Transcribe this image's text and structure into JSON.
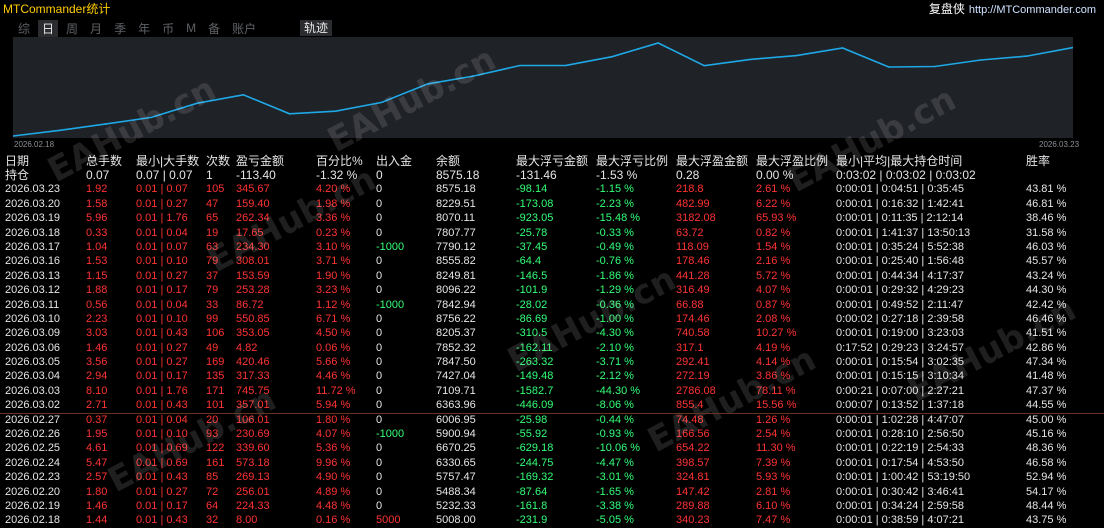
{
  "app_title": "MTCommander统计",
  "brand": {
    "name": "复盘侠",
    "url": "http://MTCommander.com"
  },
  "tabs": [
    {
      "label": "综",
      "active": false
    },
    {
      "label": "日",
      "active": true
    },
    {
      "label": "周",
      "active": false
    },
    {
      "label": "月",
      "active": false
    },
    {
      "label": "季",
      "active": false
    },
    {
      "label": "年",
      "active": false
    },
    {
      "label": "币",
      "active": false
    },
    {
      "label": "M",
      "active": false
    },
    {
      "label": "备",
      "active": false
    },
    {
      "label": "账户",
      "active": false
    }
  ],
  "track_tab": "轨迹",
  "chart": {
    "start_date": "2026.02.18",
    "end_date": "2026.03.23",
    "line_color": "#1fa8e6",
    "equity": [
      5008,
      5232.33,
      5488.34,
      5757.47,
      6330.65,
      6670.25,
      5900.94,
      6006.95,
      6363.96,
      7109.71,
      7427.04,
      7847.5,
      7852.32,
      8205.37,
      8756.22,
      7842.94,
      8096.22,
      8249.81,
      8555.82,
      7790.12,
      7807.77,
      8070.11,
      8229.51,
      8575.18
    ]
  },
  "columns": [
    "日期",
    "总手数",
    "最小|大手数",
    "次数",
    "盈亏金额",
    "百分比%",
    "出入金",
    "余额",
    "最大浮亏金额",
    "最大浮亏比例",
    "最大浮盈金额",
    "最大浮盈比例",
    "最小|平均|最大持仓时间",
    "胜率"
  ],
  "holding": {
    "label": "持仓",
    "lots": "0.07",
    "minmax": "0.07 | 0.07",
    "count": "1",
    "pnl": "-113.40",
    "pct": "-1.32 %",
    "flow": "0",
    "balance": "8575.18",
    "max_float_loss": "-131.46",
    "max_float_loss_pct": "-1.53 %",
    "max_float_profit": "0.28",
    "max_float_profit_pct": "0.00 %",
    "hold_time": "0:03:02 | 0:03:02 | 0:03:02",
    "win_rate": ""
  },
  "rows": [
    {
      "date": "2026.03.23",
      "lots": "1.92",
      "minmax": "0.01 | 0.07",
      "count": "105",
      "pnl": "345.67",
      "pct": "4.20 %",
      "flow": "0",
      "balance": "8575.18",
      "mfl": "-98.14",
      "mflp": "-1.15 %",
      "mfp": "218.8",
      "mfpp": "2.61 %",
      "hold": "0:00:01 | 0:04:51 | 0:35:45",
      "win": "43.81 %"
    },
    {
      "date": "2026.03.20",
      "lots": "1.58",
      "minmax": "0.01 | 0.27",
      "count": "47",
      "pnl": "159.40",
      "pct": "1.98 %",
      "flow": "0",
      "balance": "8229.51",
      "mfl": "-173.08",
      "mflp": "-2.23 %",
      "mfp": "482.99",
      "mfpp": "6.22 %",
      "hold": "0:00:01 | 0:16:32 | 1:42:41",
      "win": "46.81 %"
    },
    {
      "date": "2026.03.19",
      "lots": "5.96",
      "minmax": "0.01 | 1.76",
      "count": "65",
      "pnl": "262.34",
      "pct": "3.36 %",
      "flow": "0",
      "balance": "8070.11",
      "mfl": "-923.05",
      "mflp": "-15.48 %",
      "mfp": "3182.08",
      "mfpp": "65.93 %",
      "hold": "0:00:01 | 0:11:35 | 2:12:14",
      "win": "38.46 %"
    },
    {
      "date": "2026.03.18",
      "lots": "0.33",
      "minmax": "0.01 | 0.04",
      "count": "19",
      "pnl": "17.65",
      "pct": "0.23 %",
      "flow": "0",
      "balance": "7807.77",
      "mfl": "-25.78",
      "mflp": "-0.33 %",
      "mfp": "63.72",
      "mfpp": "0.82 %",
      "hold": "0:00:01 | 1:41:37 | 13:50:13",
      "win": "31.58 %"
    },
    {
      "date": "2026.03.17",
      "lots": "1.04",
      "minmax": "0.01 | 0.07",
      "count": "63",
      "pnl": "234.30",
      "pct": "3.10 %",
      "flow": "-1000",
      "balance": "7790.12",
      "mfl": "-37.45",
      "mflp": "-0.49 %",
      "mfp": "118.09",
      "mfpp": "1.54 %",
      "hold": "0:00:01 | 0:35:24 | 5:52:38",
      "win": "46.03 %"
    },
    {
      "date": "2026.03.16",
      "lots": "1.53",
      "minmax": "0.01 | 0.10",
      "count": "79",
      "pnl": "308.01",
      "pct": "3.71 %",
      "flow": "0",
      "balance": "8555.82",
      "mfl": "-64.4",
      "mflp": "-0.76 %",
      "mfp": "178.46",
      "mfpp": "2.16 %",
      "hold": "0:00:01 | 0:25:40 | 1:56:48",
      "win": "45.57 %"
    },
    {
      "date": "2026.03.13",
      "lots": "1.15",
      "minmax": "0.01 | 0.27",
      "count": "37",
      "pnl": "153.59",
      "pct": "1.90 %",
      "flow": "0",
      "balance": "8249.81",
      "mfl": "-146.5",
      "mflp": "-1.86 %",
      "mfp": "441.28",
      "mfpp": "5.72 %",
      "hold": "0:00:01 | 0:44:34 | 4:17:37",
      "win": "43.24 %"
    },
    {
      "date": "2026.03.12",
      "lots": "1.88",
      "minmax": "0.01 | 0.17",
      "count": "79",
      "pnl": "253.28",
      "pct": "3.23 %",
      "flow": "0",
      "balance": "8096.22",
      "mfl": "-101.9",
      "mflp": "-1.29 %",
      "mfp": "316.49",
      "mfpp": "4.07 %",
      "hold": "0:00:01 | 0:29:32 | 4:29:23",
      "win": "44.30 %"
    },
    {
      "date": "2026.03.11",
      "lots": "0.56",
      "minmax": "0.01 | 0.04",
      "count": "33",
      "pnl": "86.72",
      "pct": "1.12 %",
      "flow": "-1000",
      "balance": "7842.94",
      "mfl": "-28.02",
      "mflp": "-0.36 %",
      "mfp": "66.88",
      "mfpp": "0.87 %",
      "hold": "0:00:01 | 0:49:52 | 2:11:47",
      "win": "42.42 %"
    },
    {
      "date": "2026.03.10",
      "lots": "2.23",
      "minmax": "0.01 | 0.10",
      "count": "99",
      "pnl": "550.85",
      "pct": "6.71 %",
      "flow": "0",
      "balance": "8756.22",
      "mfl": "-86.69",
      "mflp": "-1.00 %",
      "mfp": "174.46",
      "mfpp": "2.08 %",
      "hold": "0:00:02 | 0:27:18 | 2:39:58",
      "win": "46.46 %"
    },
    {
      "date": "2026.03.09",
      "lots": "3.03",
      "minmax": "0.01 | 0.43",
      "count": "106",
      "pnl": "353.05",
      "pct": "4.50 %",
      "flow": "0",
      "balance": "8205.37",
      "mfl": "-310.5",
      "mflp": "-4.30 %",
      "mfp": "740.58",
      "mfpp": "10.27 %",
      "hold": "0:00:01 | 0:19:00 | 3:23:03",
      "win": "41.51 %"
    },
    {
      "date": "2026.03.06",
      "lots": "1.46",
      "minmax": "0.01 | 0.27",
      "count": "49",
      "pnl": "4.82",
      "pct": "0.06 %",
      "flow": "0",
      "balance": "7852.32",
      "mfl": "-162.11",
      "mflp": "-2.10 %",
      "mfp": "317.1",
      "mfpp": "4.19 %",
      "hold": "0:17:52 | 0:29:23 | 3:24:57",
      "win": "42.86 %"
    },
    {
      "date": "2026.03.05",
      "lots": "3.56",
      "minmax": "0.01 | 0.27",
      "count": "169",
      "pnl": "420.46",
      "pct": "5.66 %",
      "flow": "0",
      "balance": "7847.50",
      "mfl": "-263.32",
      "mflp": "-3.71 %",
      "mfp": "292.41",
      "mfpp": "4.14 %",
      "hold": "0:00:01 | 0:15:54 | 3:02:35",
      "win": "47.34 %"
    },
    {
      "date": "2026.03.04",
      "lots": "2.94",
      "minmax": "0.01 | 0.17",
      "count": "135",
      "pnl": "317.33",
      "pct": "4.46 %",
      "flow": "0",
      "balance": "7427.04",
      "mfl": "-149.48",
      "mflp": "-2.12 %",
      "mfp": "272.19",
      "mfpp": "3.86 %",
      "hold": "0:00:01 | 0:15:15 | 3:10:34",
      "win": "41.48 %"
    },
    {
      "date": "2026.03.03",
      "lots": "8.10",
      "minmax": "0.01 | 1.76",
      "count": "171",
      "pnl": "745.75",
      "pct": "11.72 %",
      "flow": "0",
      "balance": "7109.71",
      "mfl": "-1582.7",
      "mflp": "-44.30 %",
      "mfp": "2786.08",
      "mfpp": "78.11 %",
      "hold": "0:00:21 | 0:07:00 | 2:27:21",
      "win": "47.37 %"
    },
    {
      "date": "2026.03.02",
      "lots": "2.71",
      "minmax": "0.01 | 0.43",
      "count": "101",
      "pnl": "357.01",
      "pct": "5.94 %",
      "flow": "0",
      "balance": "6363.96",
      "mfl": "-446.09",
      "mflp": "-8.06 %",
      "mfp": "855.4",
      "mfpp": "15.56 %",
      "hold": "0:00:07 | 0:13:52 | 1:37:18",
      "win": "44.55 %"
    },
    {
      "date": "2026.02.27",
      "lots": "0.37",
      "minmax": "0.01 | 0.04",
      "count": "20",
      "pnl": "106.01",
      "pct": "1.80 %",
      "flow": "0",
      "balance": "6006.95",
      "mfl": "-25.98",
      "mflp": "-0.44 %",
      "mfp": "74.48",
      "mfpp": "1.26 %",
      "hold": "0:00:01 | 1:02:28 | 4:47:07",
      "win": "45.00 %"
    },
    {
      "date": "2026.02.26",
      "lots": "1.95",
      "minmax": "0.01 | 0.10",
      "count": "93",
      "pnl": "230.69",
      "pct": "4.07 %",
      "flow": "-1000",
      "balance": "5900.94",
      "mfl": "-55.92",
      "mflp": "-0.93 %",
      "mfp": "166.56",
      "mfpp": "2.54 %",
      "hold": "0:00:01 | 0:28:10 | 2:56:50",
      "win": "45.16 %"
    },
    {
      "date": "2026.02.25",
      "lots": "4.61",
      "minmax": "0.01 | 0.69",
      "count": "122",
      "pnl": "339.60",
      "pct": "5.36 %",
      "flow": "0",
      "balance": "6670.25",
      "mfl": "-629.18",
      "mflp": "-10.06 %",
      "mfp": "654.22",
      "mfpp": "11.30 %",
      "hold": "0:00:01 | 0:22:19 | 2:54:33",
      "win": "48.36 %"
    },
    {
      "date": "2026.02.24",
      "lots": "5.47",
      "minmax": "0.01 | 0.69",
      "count": "161",
      "pnl": "573.18",
      "pct": "9.96 %",
      "flow": "0",
      "balance": "6330.65",
      "mfl": "-244.75",
      "mflp": "-4.47 %",
      "mfp": "398.57",
      "mfpp": "7.39 %",
      "hold": "0:00:01 | 0:17:54 | 4:53:50",
      "win": "46.58 %"
    },
    {
      "date": "2026.02.23",
      "lots": "2.57",
      "minmax": "0.01 | 0.43",
      "count": "85",
      "pnl": "269.13",
      "pct": "4.90 %",
      "flow": "0",
      "balance": "5757.47",
      "mfl": "-169.32",
      "mflp": "-3.01 %",
      "mfp": "324.81",
      "mfpp": "5.93 %",
      "hold": "0:00:01 | 1:00:42 | 53:19:50",
      "win": "52.94 %"
    },
    {
      "date": "2026.02.20",
      "lots": "1.80",
      "minmax": "0.01 | 0.27",
      "count": "72",
      "pnl": "256.01",
      "pct": "4.89 %",
      "flow": "0",
      "balance": "5488.34",
      "mfl": "-87.64",
      "mflp": "-1.65 %",
      "mfp": "147.42",
      "mfpp": "2.81 %",
      "hold": "0:00:01 | 0:30:42 | 3:46:41",
      "win": "54.17 %"
    },
    {
      "date": "2026.02.19",
      "lots": "1.46",
      "minmax": "0.01 | 0.17",
      "count": "64",
      "pnl": "224.33",
      "pct": "4.48 %",
      "flow": "0",
      "balance": "5232.33",
      "mfl": "-161.8",
      "mflp": "-3.38 %",
      "mfp": "289.88",
      "mfpp": "6.10 %",
      "hold": "0:00:01 | 0:34:24 | 2:59:58",
      "win": "48.44 %"
    },
    {
      "date": "2026.02.18",
      "lots": "1.44",
      "minmax": "0.01 | 0.43",
      "count": "32",
      "pnl": "8.00",
      "pct": "0.16 %",
      "flow": "5000",
      "balance": "5008.00",
      "mfl": "-231.9",
      "mflp": "-5.05 %",
      "mfp": "340.23",
      "mfpp": "7.47 %",
      "hold": "0:00:01 | 0:38:59 | 4:07:21",
      "win": "43.75 %"
    }
  ],
  "watermark_text": "EAHub.cn"
}
